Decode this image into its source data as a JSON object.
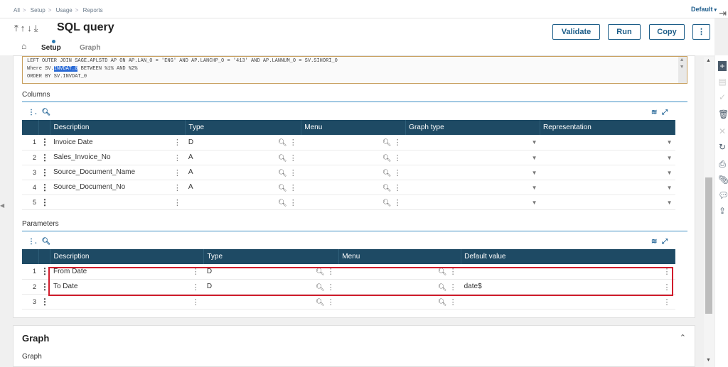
{
  "breadcrumb": [
    "All",
    "Setup",
    "Usage",
    "Reports"
  ],
  "default_link": "Default",
  "title": "SQL query",
  "nav_arrows": "⤒↑↓⤓",
  "buttons": {
    "validate": "Validate",
    "run": "Run",
    "copy": "Copy",
    "more": "⋮"
  },
  "tabs": {
    "setup": "Setup",
    "graph": "Graph"
  },
  "sql_lines": {
    "line1": "LEFT OUTER JOIN SAGE.APLSTD AP ON AP.LAN_0 = 'ENG' AND AP.LANCHP_0 = '413' AND AP.LANNUM_0 = SV.SIHORI_0",
    "line2_pre": "Where SV.",
    "line2_sel": "INVDAT_0",
    "line2_post": " BETWEEN %1% AND %2%",
    "line3": "ORDER BY SV.INVDAT_0"
  },
  "columns": {
    "label": "Columns",
    "headers": [
      "Description",
      "Type",
      "Menu",
      "Graph type",
      "Representation"
    ],
    "rows": [
      {
        "n": "1",
        "description": "Invoice Date",
        "type": "D"
      },
      {
        "n": "2",
        "description": "Sales_Invoice_No",
        "type": "A"
      },
      {
        "n": "3",
        "description": "Source_Document_Name",
        "type": "A"
      },
      {
        "n": "4",
        "description": "Source_Document_No",
        "type": "A"
      },
      {
        "n": "5",
        "description": "",
        "type": ""
      }
    ]
  },
  "parameters": {
    "label": "Parameters",
    "headers": [
      "Description",
      "Type",
      "Menu",
      "Default value"
    ],
    "rows": [
      {
        "n": "1",
        "description": "From Date",
        "type": "D",
        "default": ""
      },
      {
        "n": "2",
        "description": "To Date",
        "type": "D",
        "default": "date$"
      },
      {
        "n": "3",
        "description": "",
        "type": "",
        "default": ""
      }
    ]
  },
  "graph_section": {
    "title": "Graph",
    "sub": "Graph"
  },
  "colors": {
    "header_bg": "#1e4a64",
    "accent": "#1c5d88",
    "highlight": "#d11c2c"
  },
  "icons": [
    "home-icon",
    "search-icon",
    "layers-icon",
    "expand-icon",
    "more-vertical-icon",
    "exit-icon",
    "dropdown-icon"
  ]
}
